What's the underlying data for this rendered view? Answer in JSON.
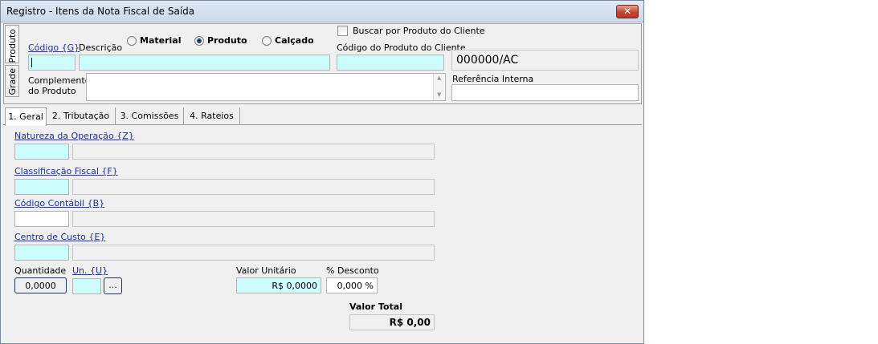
{
  "window": {
    "title": "Registro - Itens da Nota Fiscal de Saída"
  },
  "side_tabs": {
    "produto": "Produto",
    "grade": "Grade"
  },
  "product": {
    "codigo_label": "Código {G}",
    "descricao_label": "Descrição",
    "radio_material": "Material",
    "radio_produto": "Produto",
    "radio_calcado": "Calçado",
    "selected_type": "Produto",
    "buscar_cliente_label": "Buscar por Produto do Cliente",
    "codigo_cliente_label": "Código do Produto do Cliente",
    "code_display": "000000/AC",
    "complemento_label_1": "Complemento",
    "complemento_label_2": "do Produto",
    "referencia_label": "Referência Interna"
  },
  "tabs": [
    {
      "label": "1. Geral"
    },
    {
      "label": "2. Tributação"
    },
    {
      "label": "3. Comissões"
    },
    {
      "label": "4. Rateios"
    }
  ],
  "geral": {
    "natureza_label": "Natureza da Operação {Z}",
    "classificacao_label": "Classificação Fiscal {F}",
    "contabil_label": "Código Contábil {B}",
    "centro_label": "Centro de Custo {E}",
    "quantidade_label": "Quantidade",
    "quantidade_value": "0,0000",
    "unidade_label": "Un. {U}",
    "unidade_button": "...",
    "valor_unitario_label": "Valor Unitário",
    "valor_unitario_value": "R$ 0,0000",
    "desconto_label": "% Desconto",
    "desconto_value": "0,000 %",
    "valor_total_label": "Valor Total",
    "valor_total_value": "R$ 0,00"
  },
  "colors": {
    "field_cyan": "#ccfcfc",
    "link_blue": "#1a2fb8",
    "close_red": "#c7442e"
  }
}
